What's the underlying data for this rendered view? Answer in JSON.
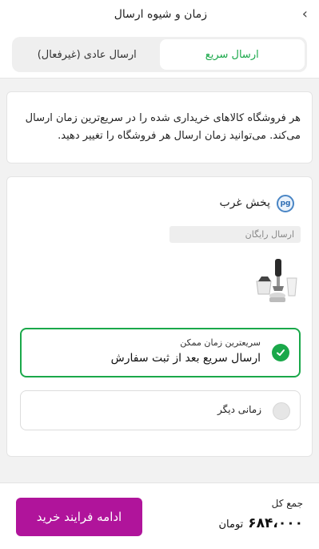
{
  "header": {
    "title": "زمان و شیوه ارسال",
    "back_icon": "chevron-right-icon"
  },
  "tabs": [
    {
      "label": "ارسال سریع",
      "active": true
    },
    {
      "label": "ارسال عادی (غیرفعال)",
      "active": false
    }
  ],
  "info": {
    "text": "هر فروشگاه کالاهای خریداری شده را در سریع‌ترین زمان ارسال می‌کند. می‌توانید زمان ارسال هر فروشگاه را تغییر دهید."
  },
  "shop": {
    "name": "پخش غرب",
    "badge": "ارسال رایگان",
    "logo_icon": "shop-logo-icon",
    "product_icon": "hand-blender-icon"
  },
  "options": {
    "selected_sub": "سریعترین زمان ممکن",
    "selected_main": "ارسال سریع بعد از ثبت سفارش",
    "other_label": "زمانی دیگر"
  },
  "footer": {
    "total_label": "جمع کل",
    "total_amount": "۶۸۴،۰۰۰",
    "currency": "تومان",
    "continue_label": "ادامه فرایند خرید"
  },
  "colors": {
    "accent_green": "#1aa84a",
    "primary_button": "#b0149b"
  }
}
